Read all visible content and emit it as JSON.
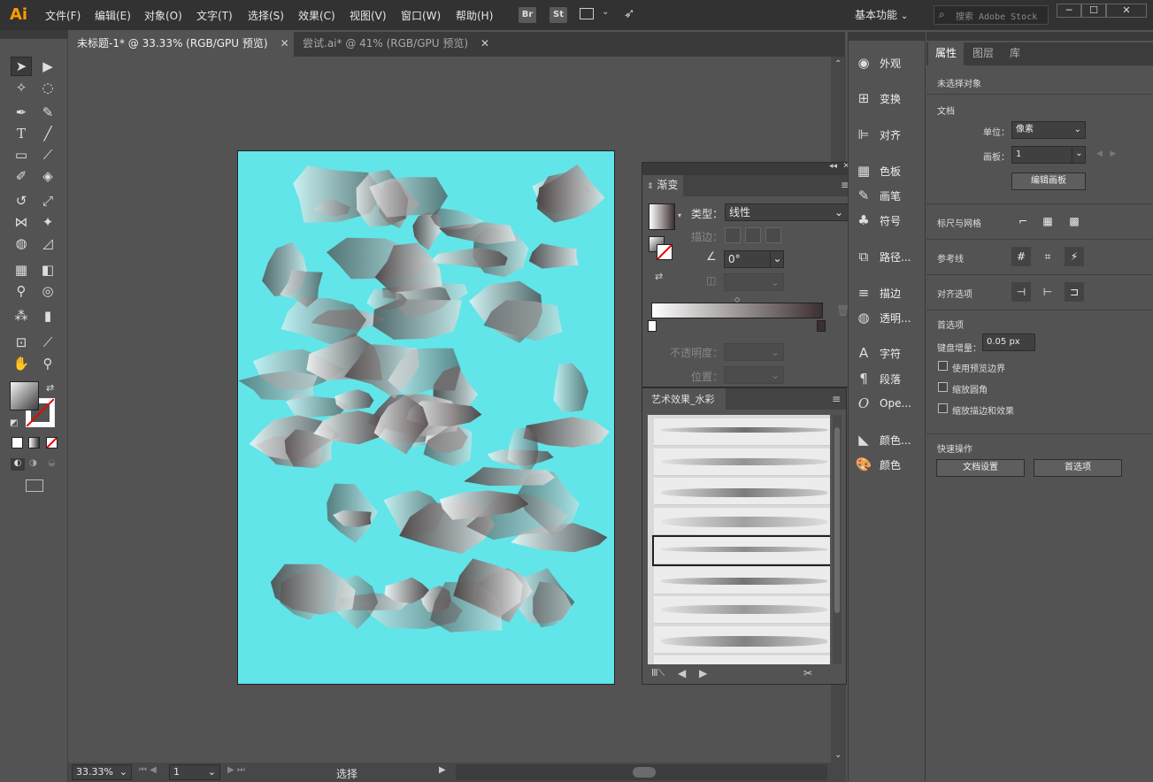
{
  "app": {
    "logo": "Ai"
  },
  "menu": [
    "文件(F)",
    "编辑(E)",
    "对象(O)",
    "文字(T)",
    "选择(S)",
    "效果(C)",
    "视图(V)",
    "窗口(W)",
    "帮助(H)"
  ],
  "menu_badges": [
    "Br",
    "St"
  ],
  "workspace": "基本功能",
  "search": {
    "placeholder": "搜索 Adobe Stock"
  },
  "window_buttons": [
    "─",
    "☐",
    "✕"
  ],
  "tabs": [
    {
      "label": "未标题-1* @ 33.33% (RGB/GPU 预览)",
      "close": "✕",
      "active": true
    },
    {
      "label": "尝试.ai* @ 41% (RGB/GPU 预览)",
      "close": "✕",
      "active": false
    }
  ],
  "tools": [
    "selection-icon",
    "direct-selection-icon",
    "magic-wand-icon",
    "lasso-icon",
    "pen-icon",
    "curvature-icon",
    "type-icon",
    "line-icon",
    "rectangle-icon",
    "paintbrush-icon",
    "shaper-icon",
    "eraser-icon",
    "rotate-icon",
    "scale-icon",
    "width-icon",
    "puppet-warp-icon",
    "shape-builder-icon",
    "perspective-icon",
    "mesh-icon",
    "gradient-icon",
    "eyedropper-icon",
    "blend-icon",
    "symbol-sprayer-icon",
    "column-graph-icon",
    "artboard-icon",
    "slice-icon",
    "hand-icon",
    "zoom-icon"
  ],
  "gradient_panel": {
    "title": "渐变",
    "type_label": "类型：",
    "type_value": "线性",
    "stroke_label": "描边：",
    "angle_value": "0°",
    "opacity_label": "不透明度：",
    "position_label": "位置：",
    "gradient_colors": [
      "#ffffff",
      "#3c2f2f"
    ]
  },
  "brush_panel": {
    "title": "艺术效果_水彩",
    "stroke_count": 9,
    "selected_index": 4
  },
  "dock": [
    {
      "label": "外观",
      "icon": "appearance-icon"
    },
    {
      "label": "变换",
      "icon": "transform-icon"
    },
    {
      "label": "对齐",
      "icon": "align-icon"
    },
    {
      "label": "色板",
      "icon": "swatches-icon"
    },
    {
      "label": "画笔",
      "icon": "brushes-icon"
    },
    {
      "label": "符号",
      "icon": "symbols-icon"
    },
    {
      "label": "路径...",
      "icon": "pathfinder-icon"
    },
    {
      "label": "描边",
      "icon": "stroke-icon"
    },
    {
      "label": "透明...",
      "icon": "transparency-icon"
    },
    {
      "label": "字符",
      "icon": "character-icon"
    },
    {
      "label": "段落",
      "icon": "paragraph-icon"
    },
    {
      "label": "Ope...",
      "icon": "opentype-icon"
    },
    {
      "label": "颜色...",
      "icon": "color-guide-icon"
    },
    {
      "label": "颜色",
      "icon": "color-icon"
    }
  ],
  "properties": {
    "tabs": [
      "属性",
      "图层",
      "库"
    ],
    "no_selection": "未选择对象",
    "document_header": "文档",
    "units_label": "单位：",
    "units_value": "像素",
    "artboard_label": "画板：",
    "artboard_value": "1",
    "edit_artboards": "编辑画板",
    "rulers_grids": "标尺与网格",
    "guides": "参考线",
    "snap_options": "对齐选项",
    "preferences_header": "首选项",
    "keyboard_increment_label": "键盘增量：",
    "keyboard_increment_value": "0.05 px",
    "checkboxes": [
      "使用预览边界",
      "缩放圆角",
      "缩放描边和效果"
    ],
    "quick_actions": "快速操作",
    "doc_setup": "文档设置",
    "preferences": "首选项"
  },
  "status": {
    "zoom": "33.33%",
    "artboard_num": "1",
    "tool": "选择"
  }
}
